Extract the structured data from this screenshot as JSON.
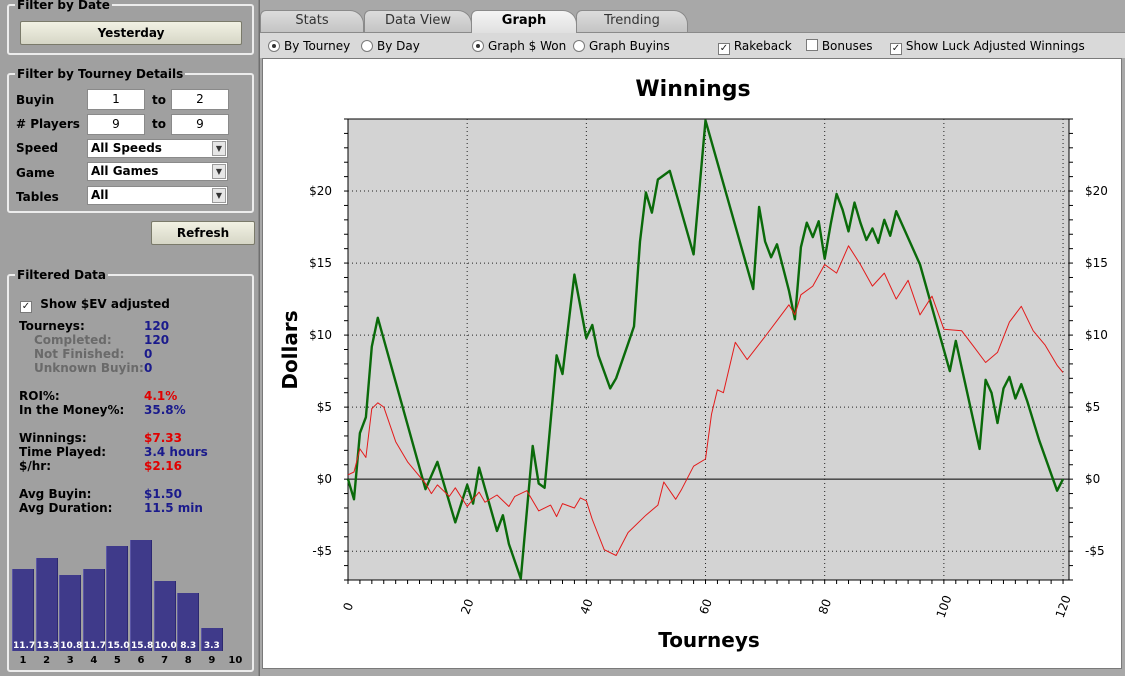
{
  "filter_date": {
    "title": "Filter by Date",
    "button": "Yesterday"
  },
  "filter_tourney": {
    "title": "Filter by Tourney Details",
    "buyin_label": "Buyin",
    "buyin_from": "1",
    "buyin_to": "2",
    "players_label": "# Players",
    "players_from": "9",
    "players_to": "9",
    "to_label": "to",
    "speed_label": "Speed",
    "speed_value": "All Speeds",
    "game_label": "Game",
    "game_value": "All Games",
    "tables_label": "Tables",
    "tables_value": "All"
  },
  "refresh_label": "Refresh",
  "filtered": {
    "title": "Filtered Data",
    "show_ev_label": "Show $EV adjusted",
    "stats": [
      {
        "label": "Tourneys:",
        "value": "120",
        "sub": false,
        "red": false
      },
      {
        "label": "Completed:",
        "value": "120",
        "sub": true,
        "red": false
      },
      {
        "label": "Not Finished:",
        "value": "0",
        "sub": true,
        "red": false
      },
      {
        "label": "Unknown Buyin:",
        "value": "0",
        "sub": true,
        "red": false
      },
      {
        "label": "ROI%:",
        "value": "4.1%",
        "sub": false,
        "red": true
      },
      {
        "label": "In the Money%:",
        "value": "35.8%",
        "sub": false,
        "red": false
      },
      {
        "label": "Winnings:",
        "value": "$7.33",
        "sub": false,
        "red": true
      },
      {
        "label": "Time Played:",
        "value": "3.4 hours",
        "sub": false,
        "red": false
      },
      {
        "label": "$/hr:",
        "value": "$2.16",
        "sub": false,
        "red": true
      },
      {
        "label": "Avg Buyin:",
        "value": "$1.50",
        "sub": false,
        "red": false
      },
      {
        "label": "Avg Duration:",
        "value": "11.5 min",
        "sub": false,
        "red": false
      }
    ],
    "histogram": {
      "labels": [
        "1",
        "2",
        "3",
        "4",
        "5",
        "6",
        "7",
        "8",
        "9",
        "10"
      ],
      "values": [
        11.7,
        13.3,
        10.8,
        11.7,
        15.0,
        15.8,
        10.0,
        8.3,
        3.3,
        0
      ],
      "value_labels": [
        "11.7",
        "13.3",
        "10.8",
        "11.7",
        "15.0",
        "15.8",
        "10.0",
        "8.3",
        "3.3",
        ""
      ]
    }
  },
  "tabs": [
    "Stats",
    "Data View",
    "Graph",
    "Trending"
  ],
  "active_tab": "Graph",
  "options": {
    "by_tourney": "By Tourney",
    "by_day": "By Day",
    "graph_won": "Graph $ Won",
    "graph_buyins": "Graph Buyins",
    "rakeback": "Rakeback",
    "bonuses": "Bonuses",
    "luck_adjusted": "Show Luck Adjusted Winnings"
  },
  "colors": {
    "winnings_line": "#0a6a0a",
    "luck_line": "#e31b1b",
    "plot_bg": "#d3d3d3",
    "hist_bar": "#3f3a8a",
    "accent_value": "#1a1a8c"
  },
  "chart_data": {
    "type": "line",
    "title": "Winnings",
    "xlabel": "Tourneys",
    "ylabel": "Dollars",
    "xlim": [
      0,
      121
    ],
    "ylim": [
      -7,
      25
    ],
    "xticks": [
      0,
      20,
      40,
      60,
      80,
      100,
      120
    ],
    "yticks": [
      -5,
      0,
      5,
      10,
      15,
      20
    ],
    "ytick_labels": [
      "-$5",
      "$0",
      "$5",
      "$10",
      "$15",
      "$20"
    ],
    "grid": true,
    "series": [
      {
        "x": [
          0,
          1,
          2,
          3,
          4,
          5,
          13,
          15,
          18,
          20,
          21,
          22,
          25,
          26,
          27,
          29,
          31,
          32,
          33,
          35,
          36,
          38,
          40,
          41,
          42,
          44,
          45,
          47,
          48,
          49,
          50,
          51,
          52,
          54,
          58,
          60,
          68,
          69,
          70,
          71,
          72,
          73,
          74,
          75,
          76,
          77,
          78,
          79,
          80,
          81,
          82,
          83,
          84,
          85,
          86,
          87,
          88,
          89,
          90,
          91,
          92,
          96,
          101,
          102,
          106,
          107,
          108,
          109,
          110,
          111,
          112,
          113,
          114,
          116,
          119,
          120
        ],
        "y": [
          0,
          -1.4,
          3.2,
          4.3,
          9.2,
          11.2,
          -0.7,
          1.2,
          -3.0,
          -0.4,
          -1.7,
          0.8,
          -3.6,
          -2.5,
          -4.5,
          -6.9,
          2.3,
          -0.3,
          -0.6,
          8.6,
          7.3,
          14.2,
          9.8,
          10.7,
          8.6,
          6.3,
          7.0,
          9.4,
          10.6,
          16.5,
          19.9,
          18.5,
          20.8,
          21.4,
          15.6,
          24.9,
          13.2,
          18.9,
          16.5,
          15.4,
          16.3,
          14.7,
          13.1,
          11.1,
          16.1,
          17.8,
          16.8,
          17.9,
          15.3,
          17.7,
          19.8,
          18.7,
          17.2,
          19.2,
          17.8,
          16.6,
          17.4,
          16.4,
          18.0,
          16.9,
          18.6,
          14.9,
          7.5,
          9.6,
          2.1,
          6.9,
          6.0,
          3.9,
          6.3,
          7.1,
          5.6,
          6.6,
          5.4,
          2.7,
          -0.8,
          0.0
        ]
      },
      {
        "x": [
          0,
          1,
          2,
          3,
          4,
          5,
          6,
          8,
          10,
          13,
          14,
          15,
          17,
          18,
          20,
          22,
          23,
          25,
          27,
          28,
          30,
          32,
          34,
          35,
          36,
          38,
          39,
          40,
          41,
          43,
          45,
          47,
          50,
          52,
          53,
          55,
          56,
          58,
          60,
          61,
          62,
          63,
          65,
          67,
          70,
          72,
          74,
          75,
          76,
          78,
          80,
          82,
          84,
          86,
          88,
          90,
          92,
          94,
          96,
          98,
          100,
          103,
          105,
          107,
          109,
          111,
          113,
          115,
          117,
          119,
          120
        ],
        "y": [
          0.3,
          0.5,
          2.1,
          1.5,
          4.9,
          5.3,
          5.0,
          2.6,
          1.2,
          -0.3,
          -1.0,
          -0.4,
          -1.2,
          -0.6,
          -1.9,
          -0.9,
          -1.6,
          -1.1,
          -1.9,
          -1.2,
          -0.8,
          -2.2,
          -1.8,
          -2.6,
          -1.7,
          -2.0,
          -1.3,
          -1.5,
          -2.8,
          -4.9,
          -5.3,
          -3.7,
          -2.5,
          -1.8,
          -0.2,
          -1.4,
          -0.7,
          0.9,
          1.4,
          4.5,
          6.2,
          6.0,
          9.5,
          8.3,
          9.9,
          11.0,
          12.1,
          11.4,
          12.8,
          13.4,
          14.9,
          14.3,
          16.2,
          14.9,
          13.4,
          14.3,
          12.5,
          13.8,
          11.4,
          12.7,
          10.4,
          10.3,
          9.2,
          8.1,
          8.8,
          10.9,
          12.0,
          10.3,
          9.3,
          7.9,
          7.4
        ]
      }
    ]
  }
}
